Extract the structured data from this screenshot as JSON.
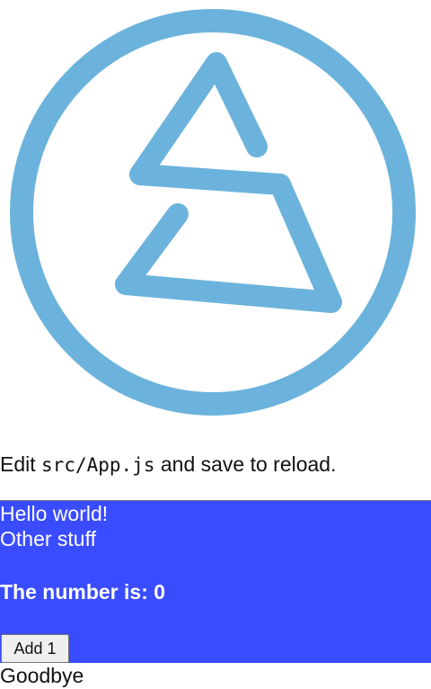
{
  "logo": {
    "icon": "triangle-s-logo-icon",
    "color": "#6bb3dc"
  },
  "intro": {
    "prefix": "Edit ",
    "code": "src/App.js",
    "suffix": " and save to reload."
  },
  "panel": {
    "background": "#3a4cff",
    "hello": "Hello world!",
    "other": "Other stuff",
    "number_label": "The number is: 0",
    "button_label": "Add 1"
  },
  "footer": {
    "goodbye": "Goodbye"
  }
}
